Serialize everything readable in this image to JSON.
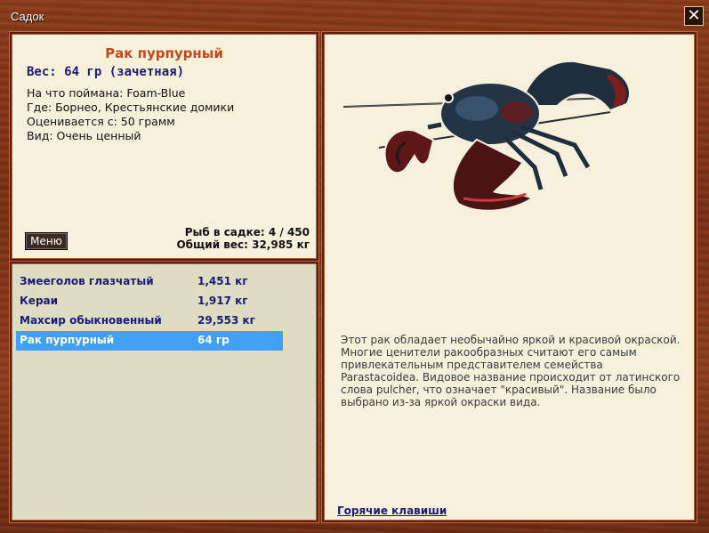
{
  "window": {
    "title": "Садок",
    "close_glyph": "✕"
  },
  "fish": {
    "name": "Рак пурпурный",
    "weight_line": "Вес: 64 гр (зачетная)",
    "info": [
      {
        "label": "На что поймана:",
        "value": "Foam-Blue"
      },
      {
        "label": "Где:",
        "value": "Борнео, Крестьянские домики"
      },
      {
        "label": "Оценивается с:",
        "value": "50 грамм"
      },
      {
        "label": "Вид:",
        "value": "Очень ценный"
      }
    ],
    "description": "Этот рак обладает необычайно яркой и красивой окраской. Многие ценители ракообразных считают его самым привлекательным представителем семейства Parastacoidea. Видовое название происходит от латинского слова pulcher, что означает \"красивый\". Название было выбрано из-за яркой окраски вида."
  },
  "menu_button": {
    "label": "Меню"
  },
  "stats": {
    "count": "Рыб в садке: 4 / 450",
    "total_weight": "Общий вес: 32,985 кг"
  },
  "catch_list": [
    {
      "name": "Змееголов глазчатый",
      "weight": "1,451 кг",
      "selected": false
    },
    {
      "name": "Кераи",
      "weight": "1,917 кг",
      "selected": false
    },
    {
      "name": "Махсир обыкновенный",
      "weight": "29,553 кг",
      "selected": false
    },
    {
      "name": "Рак пурпурный",
      "weight": "64 гр",
      "selected": true
    }
  ],
  "hotkeys_link": "Горячие клавиши",
  "colors": {
    "accent_name": "#c4481a",
    "label_blue": "#1a1a78",
    "selected_row": "#41a0f2",
    "wood": "#8a3a1a"
  }
}
